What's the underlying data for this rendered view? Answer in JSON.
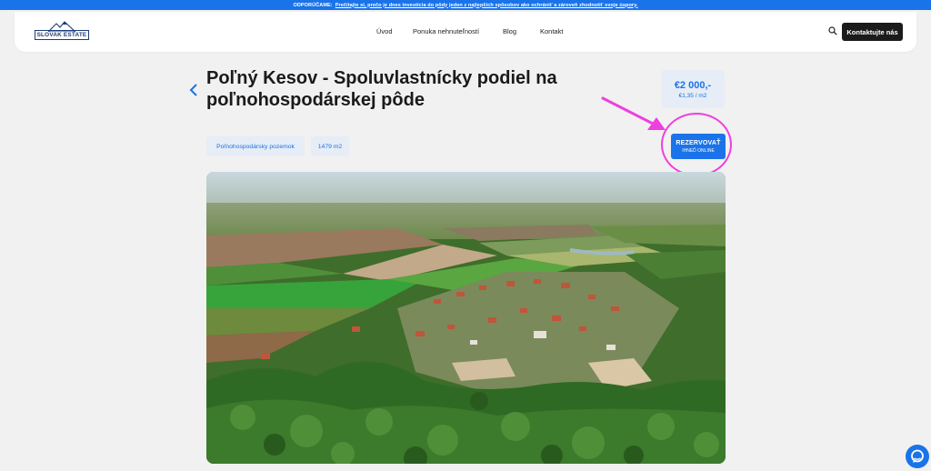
{
  "announcement": {
    "label": "ODPORÚČAME:",
    "link_text": "Prečítajte si, prečo je dnes investícia do pôdy jeden z najlepších spôsobov ako ochrániť a zároveň zhodnotiť svoje úspory."
  },
  "header": {
    "logo_text": "SLOVAK ESTATE",
    "nav": [
      "Úvod",
      "Ponuka nehnuteľností",
      "Blog",
      "Kontakt"
    ],
    "contact_label": "Kontaktujte nás"
  },
  "listing": {
    "title": "Poľný Kesov - Spoluvlastnícky podiel na poľnohospodárskej pôde",
    "price": "€2 000,-",
    "price_per_m2": "€1,35 / m2",
    "tags": [
      "Poľnohospodársky pozemok",
      "1479 m2"
    ],
    "reserve_main": "REZERVOVAŤ",
    "reserve_sub": "IHNEĎ ONLINE"
  },
  "colors": {
    "accent": "#1a73e8",
    "annotation": "#ee3fe0",
    "dark_button": "#1b1b1b"
  },
  "icons": {
    "back": "chevron-left-icon",
    "search": "search-icon",
    "chat": "chat-icon"
  }
}
